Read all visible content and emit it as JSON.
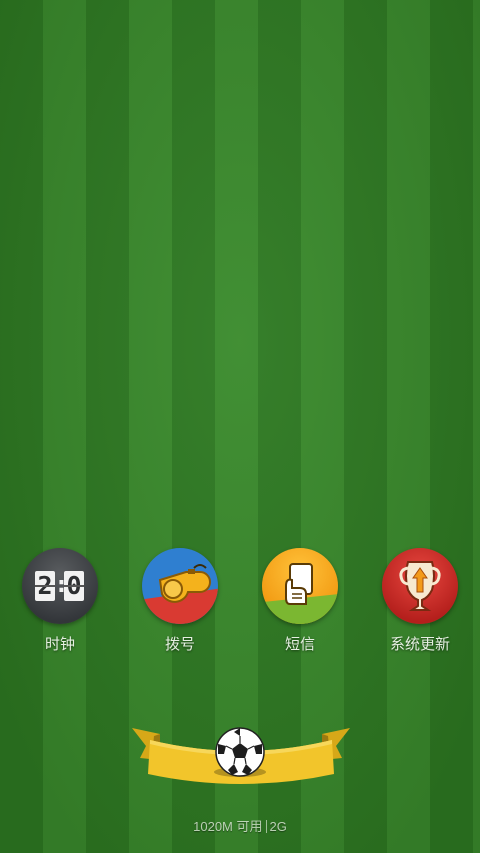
{
  "apps": [
    {
      "id": "clock",
      "label": "时钟",
      "icon": "flip-clock-icon",
      "digits_left": "2",
      "digits_right": "0",
      "colon": ":"
    },
    {
      "id": "dialer",
      "label": "拨号",
      "icon": "whistle-icon"
    },
    {
      "id": "sms",
      "label": "短信",
      "icon": "referee-card-icon"
    },
    {
      "id": "system_update",
      "label": "系统更新",
      "icon": "trophy-upgrade-icon"
    }
  ],
  "dock": {
    "icon": "soccer-ball-icon"
  },
  "status": {
    "memory": "1020M 可用",
    "network": "2G"
  },
  "colors": {
    "field_dark": "#2e7a22",
    "field_light": "#3a8b2c",
    "banner": "#f2c52b"
  }
}
